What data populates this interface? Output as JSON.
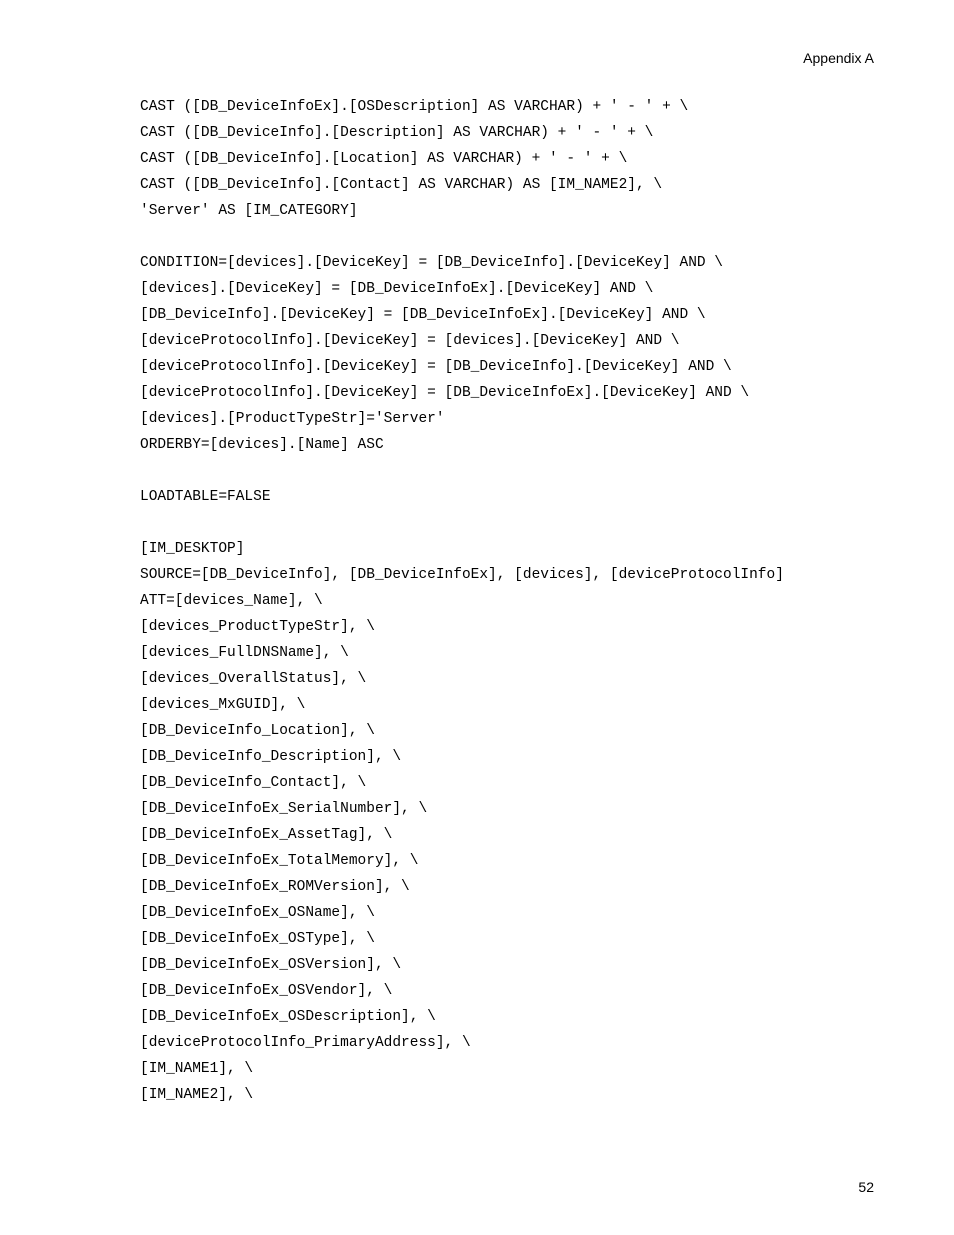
{
  "header": "Appendix A",
  "page_number": "52",
  "code_lines": [
    "CAST ([DB_DeviceInfoEx].[OSDescription] AS VARCHAR) + ' - ' + \\",
    "CAST ([DB_DeviceInfo].[Description] AS VARCHAR) + ' - ' + \\",
    "CAST ([DB_DeviceInfo].[Location] AS VARCHAR) + ' - ' + \\",
    "CAST ([DB_DeviceInfo].[Contact] AS VARCHAR) AS [IM_NAME2], \\",
    "'Server' AS [IM_CATEGORY]",
    "",
    "CONDITION=[devices].[DeviceKey] = [DB_DeviceInfo].[DeviceKey] AND \\",
    "[devices].[DeviceKey] = [DB_DeviceInfoEx].[DeviceKey] AND \\",
    "[DB_DeviceInfo].[DeviceKey] = [DB_DeviceInfoEx].[DeviceKey] AND \\",
    "[deviceProtocolInfo].[DeviceKey] = [devices].[DeviceKey] AND \\",
    "[deviceProtocolInfo].[DeviceKey] = [DB_DeviceInfo].[DeviceKey] AND \\",
    "[deviceProtocolInfo].[DeviceKey] = [DB_DeviceInfoEx].[DeviceKey] AND \\",
    "[devices].[ProductTypeStr]='Server'",
    "ORDERBY=[devices].[Name] ASC",
    "",
    "LOADTABLE=FALSE",
    "",
    "[IM_DESKTOP]",
    "SOURCE=[DB_DeviceInfo], [DB_DeviceInfoEx], [devices], [deviceProtocolInfo]",
    "ATT=[devices_Name], \\",
    "[devices_ProductTypeStr], \\",
    "[devices_FullDNSName], \\",
    "[devices_OverallStatus], \\",
    "[devices_MxGUID], \\",
    "[DB_DeviceInfo_Location], \\",
    "[DB_DeviceInfo_Description], \\",
    "[DB_DeviceInfo_Contact], \\",
    "[DB_DeviceInfoEx_SerialNumber], \\",
    "[DB_DeviceInfoEx_AssetTag], \\",
    "[DB_DeviceInfoEx_TotalMemory], \\",
    "[DB_DeviceInfoEx_ROMVersion], \\",
    "[DB_DeviceInfoEx_OSName], \\",
    "[DB_DeviceInfoEx_OSType], \\",
    "[DB_DeviceInfoEx_OSVersion], \\",
    "[DB_DeviceInfoEx_OSVendor], \\",
    "[DB_DeviceInfoEx_OSDescription], \\",
    "[deviceProtocolInfo_PrimaryAddress], \\",
    "[IM_NAME1], \\",
    "[IM_NAME2], \\"
  ]
}
